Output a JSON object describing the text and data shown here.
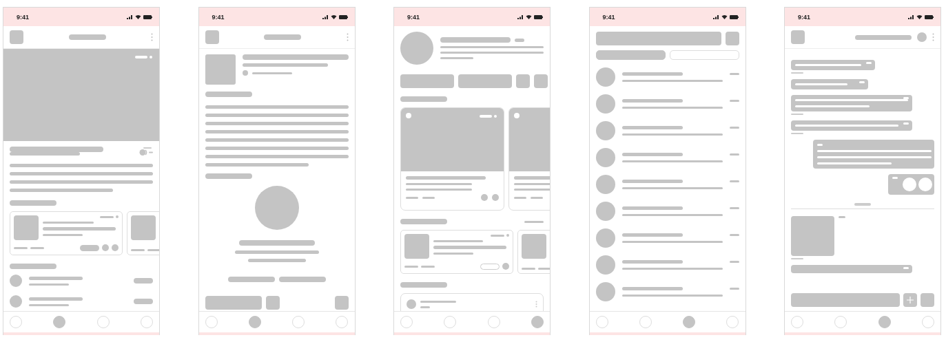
{
  "screens": [
    {
      "kind": "feed",
      "time": "9:41",
      "nav": [
        {
          "selected": false
        },
        {
          "selected": true
        },
        {
          "selected": false
        },
        {
          "selected": false
        }
      ]
    },
    {
      "kind": "article",
      "time": "9:41",
      "nav": [
        {
          "selected": false
        },
        {
          "selected": true
        },
        {
          "selected": false
        },
        {
          "selected": false
        }
      ]
    },
    {
      "kind": "profile",
      "time": "9:41",
      "nav": [
        {
          "selected": false
        },
        {
          "selected": false
        },
        {
          "selected": false
        },
        {
          "selected": true
        }
      ]
    },
    {
      "kind": "list",
      "time": "9:41",
      "nav": [
        {
          "selected": false
        },
        {
          "selected": false
        },
        {
          "selected": true
        },
        {
          "selected": false
        }
      ]
    },
    {
      "kind": "chat",
      "time": "9:41",
      "nav": [
        {
          "selected": false
        },
        {
          "selected": false
        },
        {
          "selected": true
        },
        {
          "selected": false
        }
      ]
    }
  ]
}
